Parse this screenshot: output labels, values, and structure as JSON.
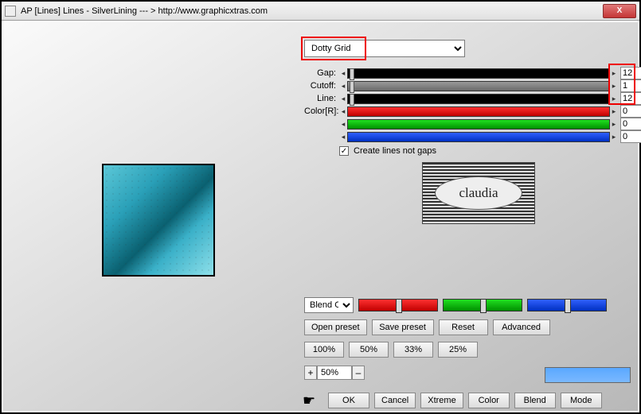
{
  "window": {
    "title": "AP [Lines]  Lines - SilverLining   --- >  http://www.graphicxtras.com",
    "close": "X"
  },
  "dropdown": {
    "selected": "Dotty Grid"
  },
  "sliders": {
    "gap": {
      "label": "Gap:",
      "value": "12"
    },
    "cutoff": {
      "label": "Cutoff:",
      "value": "1"
    },
    "line": {
      "label": "Line:",
      "value": "12"
    },
    "colorR": {
      "label": "Color[R]:",
      "value": "0"
    },
    "colorG": {
      "label": "",
      "value": "0"
    },
    "colorB": {
      "label": "",
      "value": "0"
    }
  },
  "checkbox": {
    "label": "Create lines not gaps",
    "checked": true
  },
  "logo_text": "claudia",
  "blend": {
    "label": "Blend Opti"
  },
  "buttons": {
    "open_preset": "Open preset",
    "save_preset": "Save preset",
    "reset": "Reset",
    "advanced": "Advanced",
    "p100": "100%",
    "p50": "50%",
    "p33": "33%",
    "p25": "25%",
    "ok": "OK",
    "cancel": "Cancel",
    "xtreme": "Xtreme",
    "color": "Color",
    "blend_btn": "Blend",
    "mode": "Mode"
  },
  "zoom": {
    "plus": "+",
    "value": "50%",
    "minus": "–"
  }
}
